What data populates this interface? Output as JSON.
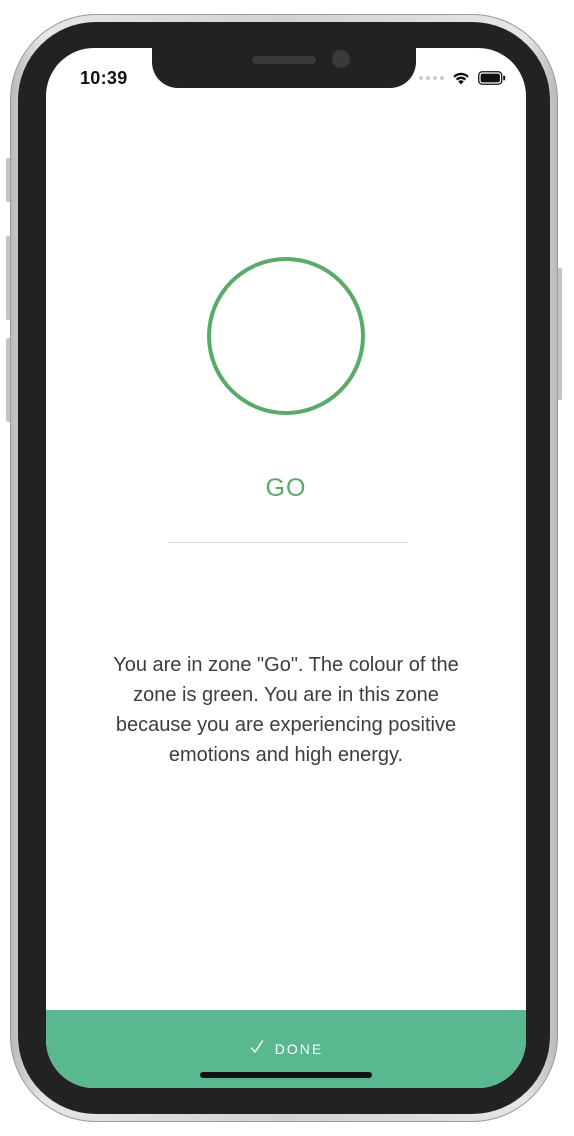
{
  "status_bar": {
    "time": "10:39"
  },
  "zone": {
    "title": "GO",
    "color": "#5aaa69",
    "description": "You are in zone \"Go\". The colour of the zone is green. You are in this zone because you are experiencing positive emotions and high energy."
  },
  "done_button": {
    "label": "DONE",
    "icon": "check-icon",
    "background": "#5ab890"
  },
  "icons": {
    "signal": "signal-dots-icon",
    "wifi": "wifi-icon",
    "battery": "battery-icon"
  }
}
